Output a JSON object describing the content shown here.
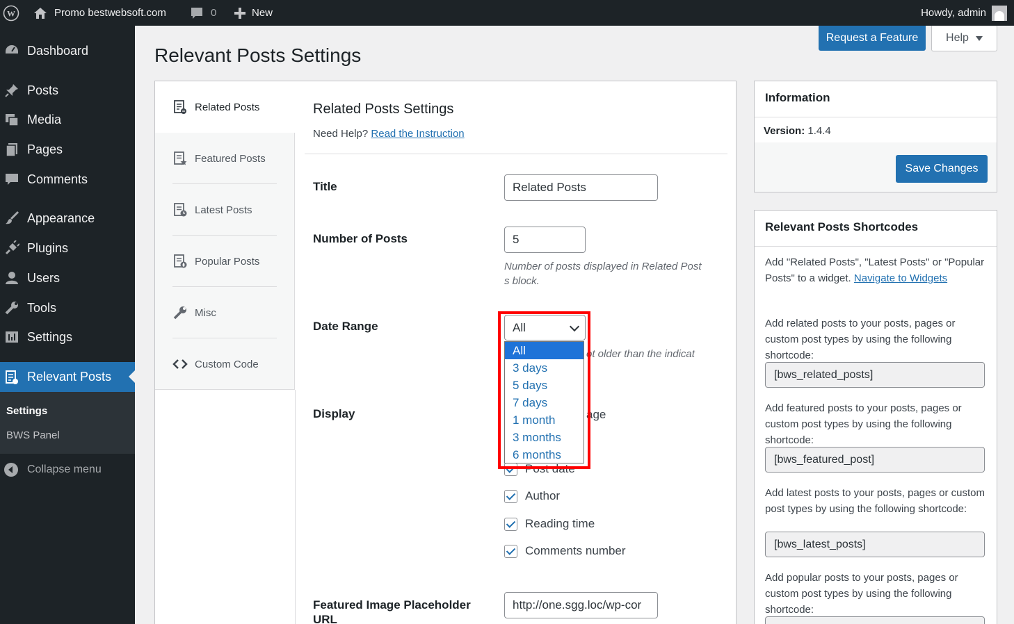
{
  "admin_bar": {
    "site_name": "Promo bestwebsoft.com",
    "comments_count": "0",
    "new_label": "New",
    "howdy": "Howdy, admin"
  },
  "sidebar": {
    "items": [
      {
        "label": "Dashboard",
        "icon": "dashboard-icon"
      },
      {
        "label": "Posts",
        "icon": "pin-icon"
      },
      {
        "label": "Media",
        "icon": "media-icon"
      },
      {
        "label": "Pages",
        "icon": "pages-icon"
      },
      {
        "label": "Comments",
        "icon": "comment-icon"
      },
      {
        "label": "Appearance",
        "icon": "brush-icon"
      },
      {
        "label": "Plugins",
        "icon": "plug-icon"
      },
      {
        "label": "Users",
        "icon": "user-icon"
      },
      {
        "label": "Tools",
        "icon": "wrench-icon"
      },
      {
        "label": "Settings",
        "icon": "settings-icon"
      },
      {
        "label": "Relevant Posts",
        "icon": "relevant-posts-icon"
      }
    ],
    "submenu": [
      "Settings",
      "BWS Panel"
    ],
    "collapse": "Collapse menu"
  },
  "header": {
    "title": "Relevant Posts Settings",
    "request_feature": "Request a Feature",
    "help": "Help"
  },
  "tabs": [
    {
      "label": "Related Posts"
    },
    {
      "label": "Featured Posts"
    },
    {
      "label": "Latest Posts"
    },
    {
      "label": "Popular Posts"
    },
    {
      "label": "Misc"
    },
    {
      "label": "Custom Code"
    }
  ],
  "settings": {
    "section_title": "Related Posts Settings",
    "need_help": "Need Help?",
    "instruction_link": "Read the Instruction",
    "title_label": "Title",
    "title_value": "Related Posts",
    "num_label": "Number of Posts",
    "num_value": "5",
    "num_desc_1": "Number of posts displayed in Related Post",
    "num_desc_2": "s block.",
    "date_label": "Date Range",
    "date_value": "All",
    "date_desc_partial": "ot older than the indicat",
    "date_options": [
      "All",
      "3 days",
      "5 days",
      "7 days",
      "1 month",
      "3 months",
      "6 months"
    ],
    "display_label": "Display",
    "display_partial": "age",
    "display_options": [
      {
        "label": "Post date",
        "checked": true
      },
      {
        "label": "Author",
        "checked": true
      },
      {
        "label": "Reading time",
        "checked": true
      },
      {
        "label": "Comments number",
        "checked": true
      }
    ],
    "placeholder_label_1": "Featured Image Placeholder",
    "placeholder_label_2": "URL",
    "placeholder_value": "http://one.sgg.loc/wp-cor"
  },
  "info_box": {
    "title": "Information",
    "version_label": "Version:",
    "version_value": "1.4.4",
    "save": "Save Changes"
  },
  "shortcodes_box": {
    "title": "Relevant Posts Shortcodes",
    "intro_1": "Add \"Related Posts\", \"Latest Posts\" or \"Popular Posts\" to a widget.",
    "intro_link": "Navigate to Widgets",
    "related_text": "Add related posts to your posts, pages or custom post types by using the following shortcode:",
    "related_code": "[bws_related_posts]",
    "featured_text": "Add featured posts to your posts, pages or custom post types by using the following shortcode:",
    "featured_code": "[bws_featured_post]",
    "latest_text": "Add latest posts to your posts, pages or custom post types by using the following shortcode:",
    "latest_code": "[bws_latest_posts]",
    "popular_text": "Add popular posts to your posts, pages or custom post types by using the following shortcode:"
  },
  "colors": {
    "admin_dark": "#1d2327",
    "accent": "#2271b1",
    "highlight": "#ff0000"
  }
}
